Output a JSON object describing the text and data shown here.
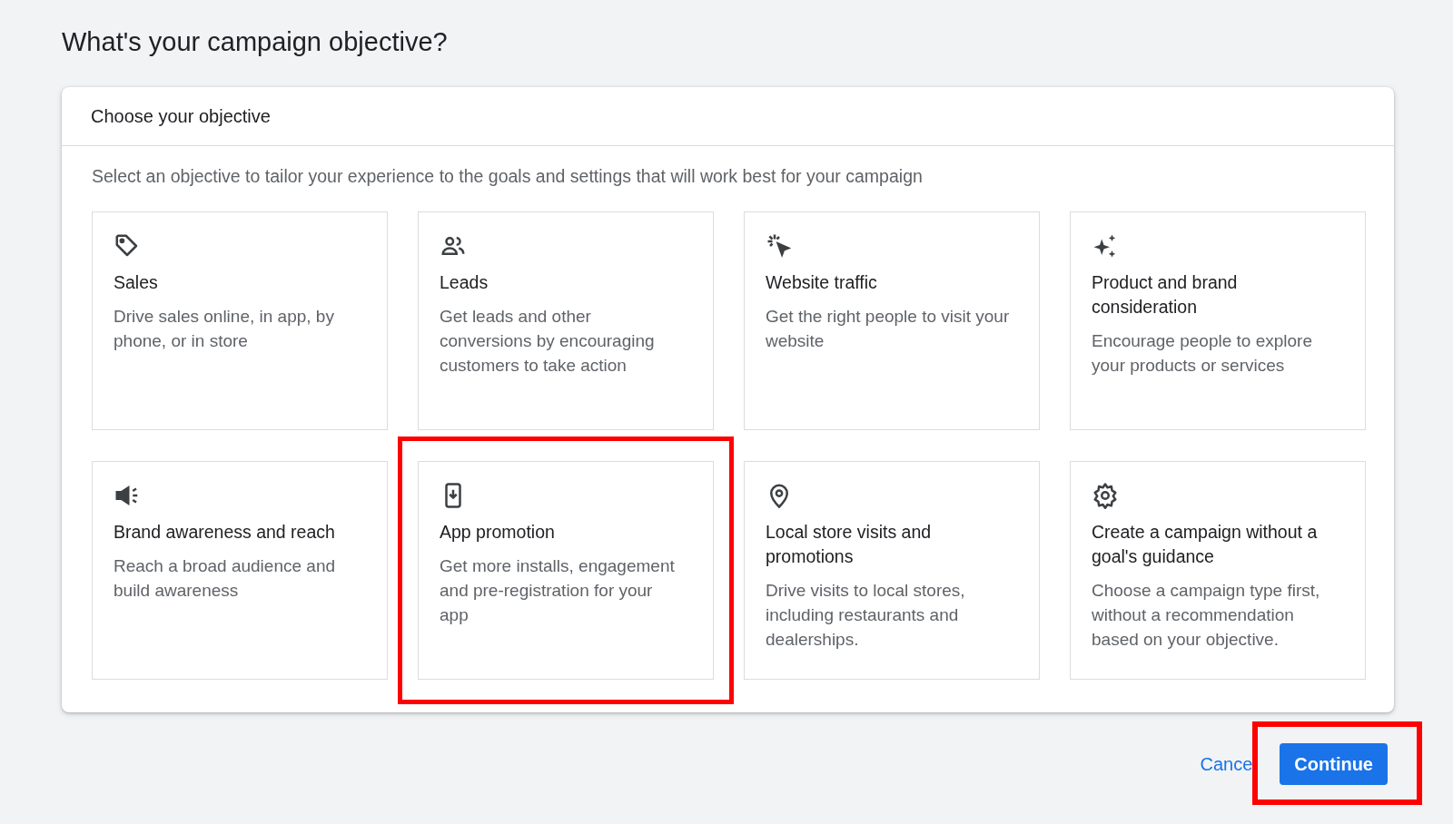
{
  "page_title": "What's your campaign objective?",
  "panel": {
    "title": "Choose your objective",
    "description": "Select an objective to tailor your experience to the goals and settings that will work best for your campaign"
  },
  "objectives": [
    {
      "kind": "tag",
      "title": "Sales",
      "description": "Drive sales online, in app, by phone, or in store",
      "highlighted": false
    },
    {
      "kind": "people",
      "title": "Leads",
      "description": "Get leads and other conversions by encouraging customers to take action",
      "highlighted": false
    },
    {
      "kind": "click",
      "title": "Website traffic",
      "description": "Get the right people to visit your website",
      "highlighted": false
    },
    {
      "kind": "sparkle",
      "title": "Product and brand consideration",
      "description": "Encourage people to explore your products or services",
      "highlighted": false
    },
    {
      "kind": "megaphone",
      "title": "Brand awareness and reach",
      "description": "Reach a broad audience and build awareness",
      "highlighted": false
    },
    {
      "kind": "phone",
      "title": "App promotion",
      "description": "Get more installs, engagement and pre-registration for your app",
      "highlighted": true
    },
    {
      "kind": "pin",
      "title": "Local store visits and promotions",
      "description": "Drive visits to local stores, including restaurants and dealerships.",
      "highlighted": false
    },
    {
      "kind": "gear",
      "title": "Create a campaign without a goal's guidance",
      "description": "Choose a campaign type first, without a recommendation based on your objective.",
      "highlighted": false
    }
  ],
  "actions": {
    "cancel": "Cance",
    "continue": {
      "label": "Continue",
      "highlighted": true
    }
  }
}
